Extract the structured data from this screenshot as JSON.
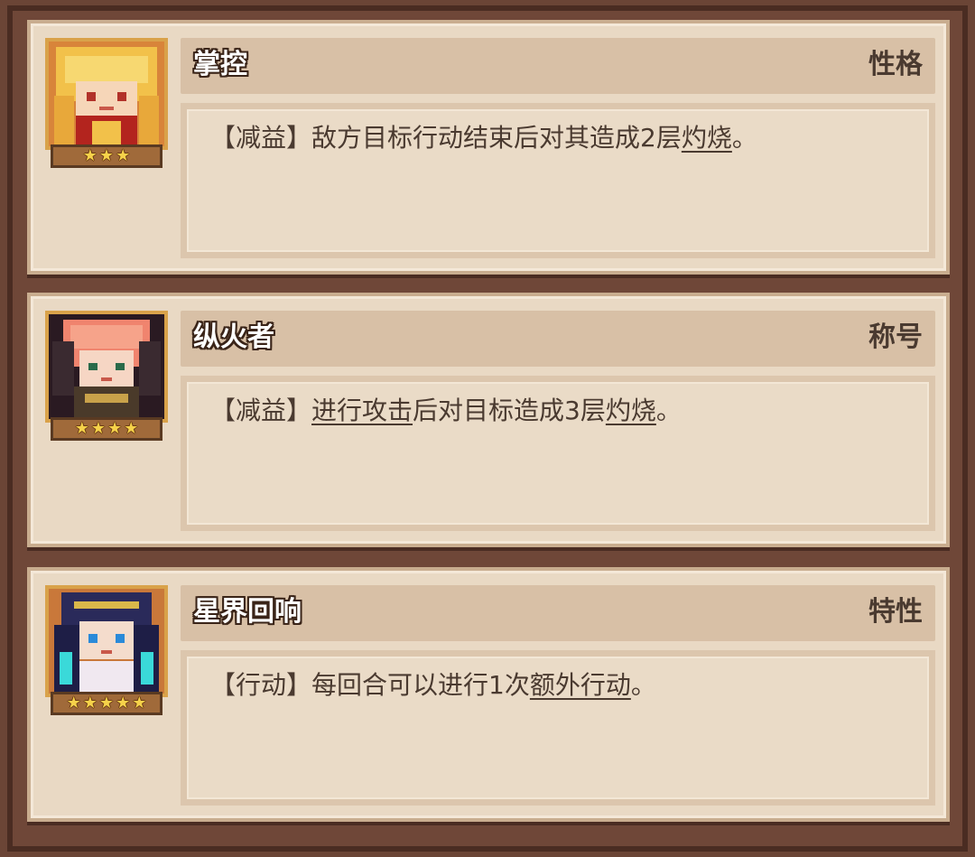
{
  "traits": [
    {
      "name": "掌控",
      "category": "性格",
      "stars": 3,
      "description": {
        "tag": "【减益】",
        "parts": [
          {
            "text": "敌方目标行动结束后对其造成2层",
            "keyword": false
          },
          {
            "text": "灼烧",
            "keyword": true
          },
          {
            "text": "。",
            "keyword": false
          }
        ]
      }
    },
    {
      "name": "纵火者",
      "category": "称号",
      "stars": 4,
      "description": {
        "tag": "【减益】",
        "parts": [
          {
            "text": "进行攻击",
            "keyword": true
          },
          {
            "text": "后对目标造成3层",
            "keyword": false
          },
          {
            "text": "灼烧",
            "keyword": true
          },
          {
            "text": "。",
            "keyword": false
          }
        ]
      }
    },
    {
      "name": "星界回响",
      "category": "特性",
      "stars": 5,
      "description": {
        "tag": "【行动】",
        "parts": [
          {
            "text": "每回合可以进行1次",
            "keyword": false
          },
          {
            "text": "额外行动",
            "keyword": true
          },
          {
            "text": "。",
            "keyword": false
          }
        ]
      }
    }
  ],
  "colors": {
    "background": "#6b4536",
    "card": "#e9d9c4",
    "star": "#f6d24a",
    "text": "#4a3a30"
  },
  "icons": {
    "star": "star-icon",
    "portrait_1": "blonde-character-portrait",
    "portrait_2": "red-haired-character-portrait",
    "portrait_3": "dark-haired-character-portrait"
  }
}
